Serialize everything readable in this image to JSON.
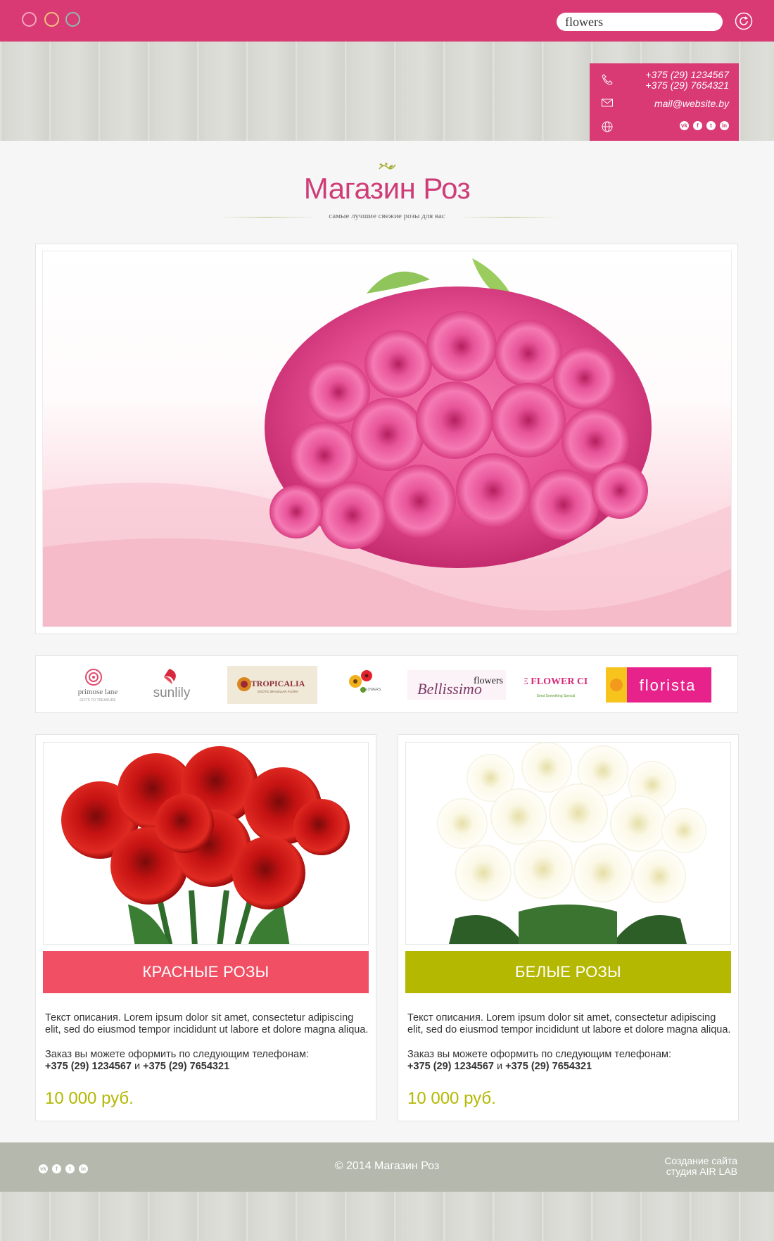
{
  "topbar": {
    "search_value": "flowers",
    "dot_colors": [
      "#f3a7c0",
      "#f2c37c",
      "#8fb9b4"
    ]
  },
  "contact": {
    "phone1": "+375 (29) 1234567",
    "phone2": "+375 (29) 7654321",
    "email": "mail@website.by",
    "social": [
      "vk",
      "f",
      "t",
      "in"
    ]
  },
  "logo": {
    "title": "Магазин Роз",
    "subtitle": "самые лучшие свежие розы для вас"
  },
  "brands": [
    {
      "name": "primose lane",
      "tagline": "GIFTS TO TREASURE"
    },
    {
      "name": "sunlily"
    },
    {
      "name": "TROPICALIA",
      "tagline": "EXOTIC BRAZILIAN FLORA"
    },
    {
      "name": "FLOWERS"
    },
    {
      "name": "Bellissimo",
      "extra": "flowers"
    },
    {
      "name": "THE FLOWER CLUB",
      "tagline": "Send Something Special"
    },
    {
      "name": "florista"
    }
  ],
  "products": [
    {
      "title": "КРАСНЫЕ РОЗЫ",
      "color": "#f04f64",
      "desc": "Текст описания. Lorem ipsum dolor sit amet, consectetur adipiscing elit, sed do eiusmod tempor incididunt ut labore et dolore magna aliqua.",
      "order_label": "Заказ вы можете оформить по следующим телефонам:",
      "phone1": "+375 (29) 1234567",
      "and": " и ",
      "phone2": "+375 (29) 7654321",
      "price": "10 000 руб."
    },
    {
      "title": "БЕЛЫЕ РОЗЫ",
      "color": "#b4b800",
      "desc": "Текст описания. Lorem ipsum dolor sit amet, consectetur adipiscing elit, sed do eiusmod tempor incididunt ut labore et dolore magna aliqua.",
      "order_label": "Заказ вы можете оформить по следующим телефонам:",
      "phone1": "+375 (29) 1234567",
      "and": " и ",
      "phone2": "+375 (29) 7654321",
      "price": "10 000 руб."
    }
  ],
  "footer": {
    "copyright": "© 2014   Магазин Роз",
    "studio_line1": "Создание сайта",
    "studio_line2": "студия AIR LAB",
    "social": [
      "vk",
      "f",
      "t",
      "in"
    ]
  },
  "colors": {
    "brand_pink": "#d93a73",
    "price_green": "#b4b800"
  }
}
